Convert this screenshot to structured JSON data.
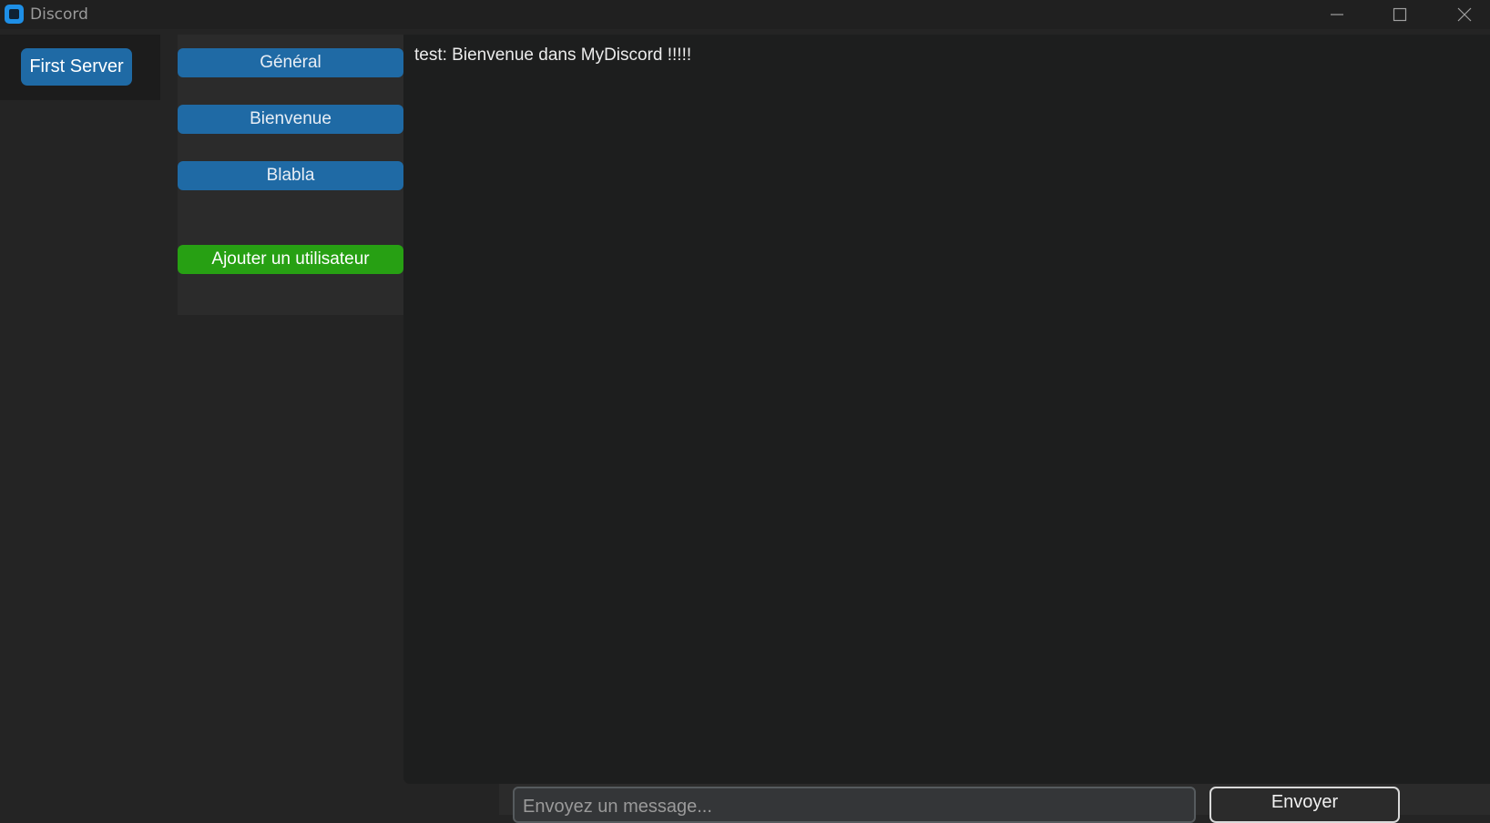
{
  "window": {
    "title": "Discord",
    "icon": "app-icon",
    "controls": [
      "minimize-icon",
      "maximize-icon",
      "close-icon"
    ],
    "accent": "#1e8fe6"
  },
  "servers": [
    {
      "label": "First Server"
    }
  ],
  "channels": [
    {
      "label": "Général"
    },
    {
      "label": "Bienvenue"
    },
    {
      "label": "Blabla"
    }
  ],
  "add_user_label": "Ajouter un utilisateur",
  "messages": [
    {
      "text": "test: Bienvenue dans MyDiscord !!!!!"
    }
  ],
  "composer": {
    "placeholder": "Envoyez un message...",
    "value": "",
    "send_label": "Envoyer"
  },
  "colors": {
    "button_blue": "#1f6aa5",
    "button_green": "#27a013",
    "background": "#242424",
    "message_panel": "#1d1e1e"
  }
}
